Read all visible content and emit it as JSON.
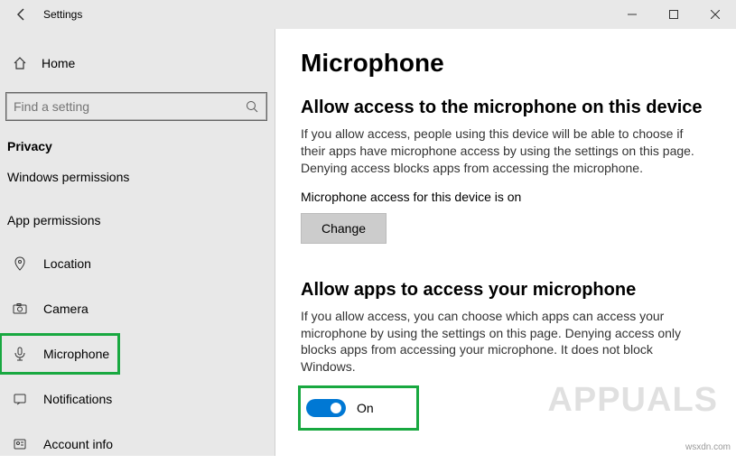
{
  "window": {
    "title": "Settings"
  },
  "sidebar": {
    "home": "Home",
    "search_placeholder": "Find a setting",
    "group_heading": "Privacy",
    "win_permissions": "Windows permissions",
    "app_permissions": "App permissions",
    "items": {
      "location": "Location",
      "camera": "Camera",
      "microphone": "Microphone",
      "notifications": "Notifications",
      "account_info": "Account info"
    }
  },
  "page": {
    "title": "Microphone",
    "section1": {
      "heading": "Allow access to the microphone on this device",
      "body": "If you allow access, people using this device will be able to choose if their apps have microphone access by using the settings on this page. Denying access blocks apps from accessing the microphone.",
      "status": "Microphone access for this device is on",
      "change_btn": "Change"
    },
    "section2": {
      "heading": "Allow apps to access your microphone",
      "body": "If you allow access, you can choose which apps can access your microphone by using the settings on this page. Denying access only blocks apps from accessing your microphone. It does not block Windows.",
      "toggle_label": "On"
    }
  },
  "watermark": "APPUALS",
  "attribution": "wsxdn.com"
}
